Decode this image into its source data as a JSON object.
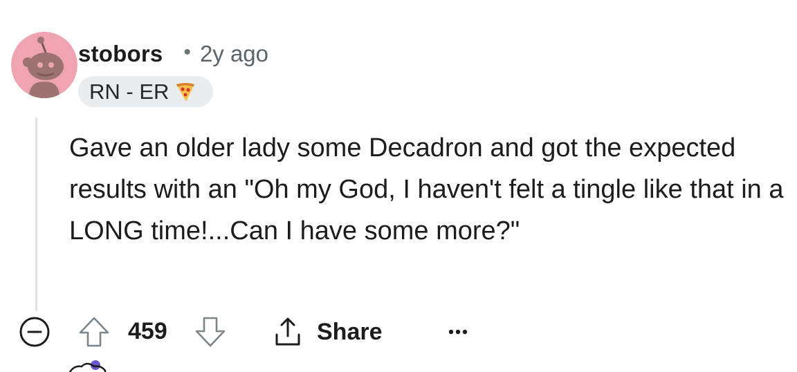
{
  "comment": {
    "username": "stobors",
    "separator": "•",
    "timestamp": "2y ago",
    "flair": {
      "text": "RN - ER",
      "icon": "pizza-icon"
    },
    "body": "Gave an older lady some Decadron and got the expected results with an \"Oh my God, I haven't felt a tingle like that in a LONG time!...Can I have some more?\"",
    "score": "459",
    "share_label": "Share",
    "more_label": "•••",
    "avatar_color": "#f0a3b0"
  },
  "icons": {
    "collapse": "collapse-minus-icon",
    "upvote": "arrow-up-icon",
    "downvote": "arrow-down-icon",
    "share": "share-icon",
    "more": "ellipsis-icon"
  }
}
